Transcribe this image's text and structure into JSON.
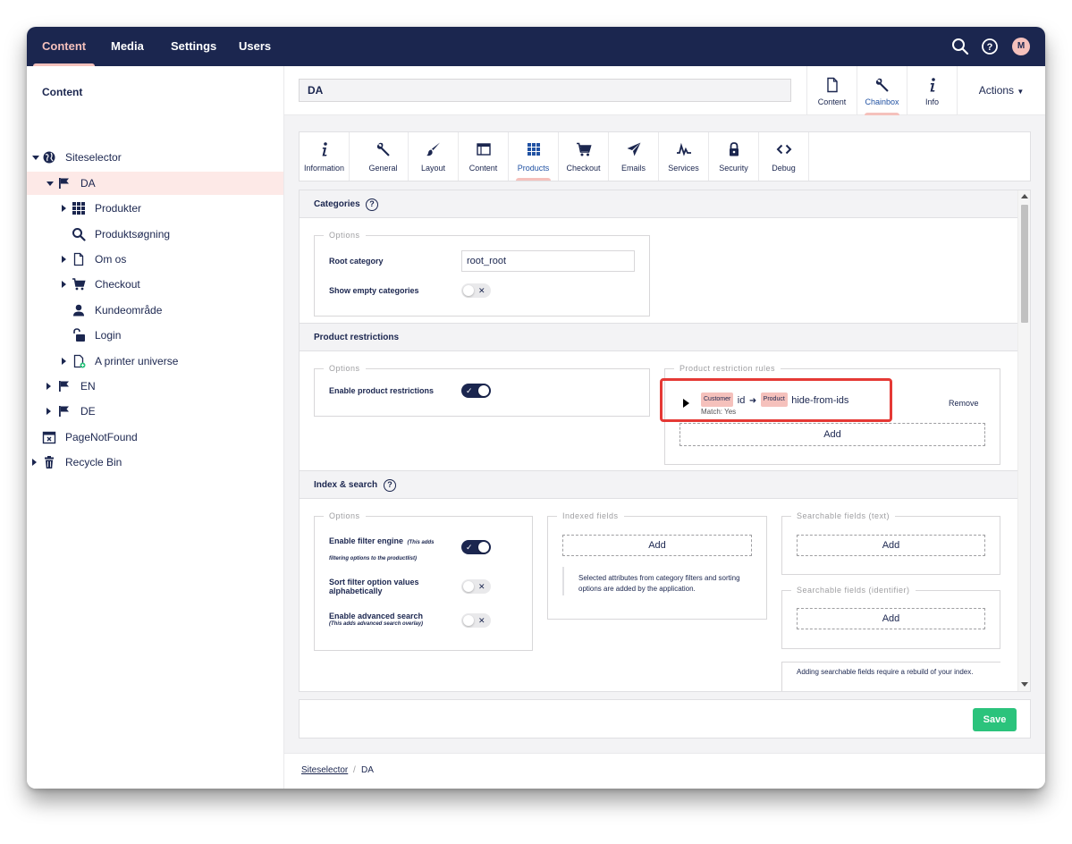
{
  "topbar": {
    "nav": [
      "Content",
      "Media",
      "Settings",
      "Users"
    ],
    "active_nav": "Content",
    "avatar_initial": "M"
  },
  "tree": {
    "title": "Content",
    "items": [
      {
        "label": "Siteselector",
        "icon": "globe-icon"
      },
      {
        "label": "DA",
        "icon": "flag-icon",
        "selected": true
      },
      {
        "label": "Produkter",
        "icon": "grid-icon"
      },
      {
        "label": "Produktsøgning",
        "icon": "search-icon"
      },
      {
        "label": "Om os",
        "icon": "document-icon"
      },
      {
        "label": "Checkout",
        "icon": "cart-icon"
      },
      {
        "label": "Kundeområde",
        "icon": "user-icon"
      },
      {
        "label": "Login",
        "icon": "unlock-icon"
      },
      {
        "label": "A printer universe",
        "icon": "document-add-icon"
      },
      {
        "label": "EN",
        "icon": "flag-icon"
      },
      {
        "label": "DE",
        "icon": "flag-icon"
      },
      {
        "label": "PageNotFound",
        "icon": "calendar-x-icon"
      },
      {
        "label": "Recycle Bin",
        "icon": "trash-icon"
      }
    ]
  },
  "header": {
    "name_value": "DA",
    "apps": [
      {
        "label": "Content",
        "icon": "document-icon"
      },
      {
        "label": "Chainbox",
        "icon": "wrench-icon",
        "active": true
      },
      {
        "label": "Info",
        "icon": "info-icon"
      }
    ],
    "actions_label": "Actions"
  },
  "subtabs": [
    {
      "label": "Information",
      "icon": "info-icon"
    },
    {
      "label": "General",
      "icon": "wrench-icon"
    },
    {
      "label": "Layout",
      "icon": "brush-icon"
    },
    {
      "label": "Content",
      "icon": "window-icon"
    },
    {
      "label": "Products",
      "icon": "grid-icon",
      "active": true
    },
    {
      "label": "Checkout",
      "icon": "cart-icon"
    },
    {
      "label": "Emails",
      "icon": "send-icon"
    },
    {
      "label": "Services",
      "icon": "pulse-icon"
    },
    {
      "label": "Security",
      "icon": "lock-icon"
    },
    {
      "label": "Debug",
      "icon": "code-icon"
    }
  ],
  "sections": {
    "categories": {
      "title": "Categories",
      "options_legend": "Options",
      "root_category_label": "Root category",
      "root_category_value": "root_root",
      "show_empty_label": "Show empty categories",
      "show_empty_on": false
    },
    "restrictions": {
      "title": "Product restrictions",
      "options_legend": "Options",
      "enable_label": "Enable product restrictions",
      "enable_on": true,
      "rules_legend": "Product restriction rules",
      "rule": {
        "customer_tag": "Customer",
        "customer_field": "id",
        "product_tag": "Product",
        "product_field": "hide-from-ids",
        "match_text": "Match: Yes"
      },
      "remove_label": "Remove",
      "add_label": "Add"
    },
    "index": {
      "title": "Index & search",
      "options_legend": "Options",
      "filter_engine_label": "Enable filter engine",
      "filter_engine_note": "(This adds filtering options to the productlist)",
      "filter_engine_on": true,
      "sort_label": "Sort filter option values alphabetically",
      "sort_on": false,
      "advanced_label": "Enable advanced search",
      "advanced_note": "(This adds advanced search overlay)",
      "advanced_on": false,
      "indexed_legend": "Indexed fields",
      "indexed_add": "Add",
      "indexed_desc": "Selected attributes from category filters and sorting options are added by the application.",
      "searchable_text_legend": "Searchable fields (text)",
      "searchable_text_add": "Add",
      "searchable_id_legend": "Searchable fields (identifier)",
      "searchable_id_add": "Add",
      "searchable_desc": "Adding searchable fields require a rebuild of your index."
    }
  },
  "footer": {
    "save_label": "Save",
    "breadcrumb": [
      "Siteselector",
      "/",
      "DA"
    ]
  },
  "colors": {
    "navy": "#1b264f",
    "accent_pink": "#f5c1bc",
    "selected_row": "#fde9e7",
    "save_green": "#2bc37c",
    "highlight_red": "#e53935"
  }
}
